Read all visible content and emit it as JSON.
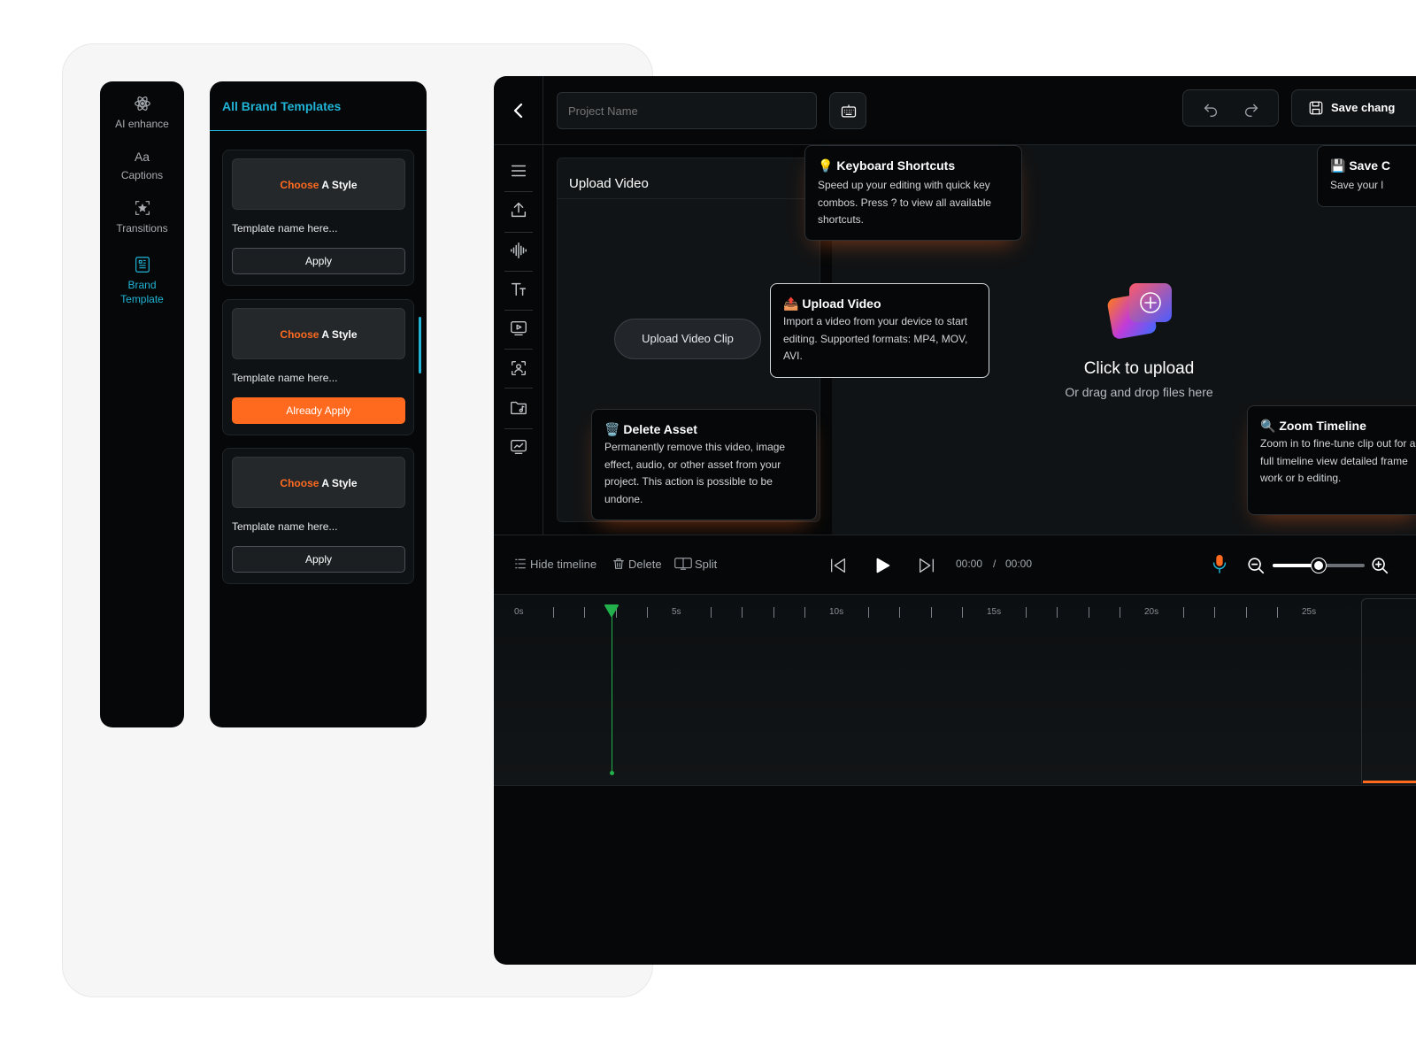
{
  "sidebar": {
    "items": [
      {
        "label": "AI enhance",
        "icon": "atom-icon",
        "active": false
      },
      {
        "label": "Captions",
        "icon": "captions-icon",
        "glyph": "Aa",
        "active": false
      },
      {
        "label": "Transitions",
        "icon": "transitions-icon",
        "active": false
      },
      {
        "label": "Brand Template",
        "label_lines": [
          "Brand",
          "Template"
        ],
        "icon": "brand-template-icon",
        "active": true
      }
    ]
  },
  "templates": {
    "title": "All Brand Templates",
    "cards": [
      {
        "style_accent": "Choose",
        "style_rest": "A Style",
        "name": "Template name here...",
        "button": "Apply",
        "button_state": "default"
      },
      {
        "style_accent": "Choose",
        "style_rest": "A Style",
        "name": "Template name here...",
        "button": "Already Apply",
        "button_state": "applied"
      },
      {
        "style_accent": "Choose",
        "style_rest": "A Style",
        "name": "Template name here...",
        "button": "Apply",
        "button_state": "default"
      }
    ]
  },
  "editor": {
    "project_name_placeholder": "Project Name",
    "save_label": "Save chang",
    "upload_panel_title": "Upload Video",
    "upload_clip_button": "Upload Video Clip",
    "click_to_upload": "Click to upload",
    "drag_drop": "Or drag and drop files here"
  },
  "tooltips": {
    "keyboard": {
      "emoji": "💡",
      "title": "Keyboard Shortcuts",
      "body": "Speed up your editing with quick key combos. Press ? to view all available shortcuts."
    },
    "save": {
      "emoji": "💾",
      "title": "Save C",
      "body": "Save your l"
    },
    "upload": {
      "emoji": "📤",
      "title": "Upload Video",
      "body": "Import a video from your device to start editing. Supported formats: MP4, MOV, AVI."
    },
    "delete": {
      "emoji": "🗑️",
      "title": "Delete Asset",
      "body": "Permanently remove this video, image effect, audio, or other asset from your project. This action is possible to be undone."
    },
    "zoom": {
      "emoji": "🔍",
      "title": "Zoom Timeline",
      "body": "Zoom in to fine-tune clip out for a full timeline view detailed frame work or b editing."
    }
  },
  "timeline": {
    "hide_timeline": "Hide timeline",
    "delete": "Delete",
    "split": "Split",
    "current_time": "00:00",
    "separator": "/",
    "total_time": "00:00",
    "zoom_level": 0.5,
    "ruler_labels": [
      "0s",
      "5s",
      "10s",
      "15s",
      "20s",
      "25s"
    ]
  },
  "colors": {
    "accent": "#21b4d6",
    "orange": "#ff6a1f",
    "playhead": "#21b04b",
    "background": "#050708"
  }
}
